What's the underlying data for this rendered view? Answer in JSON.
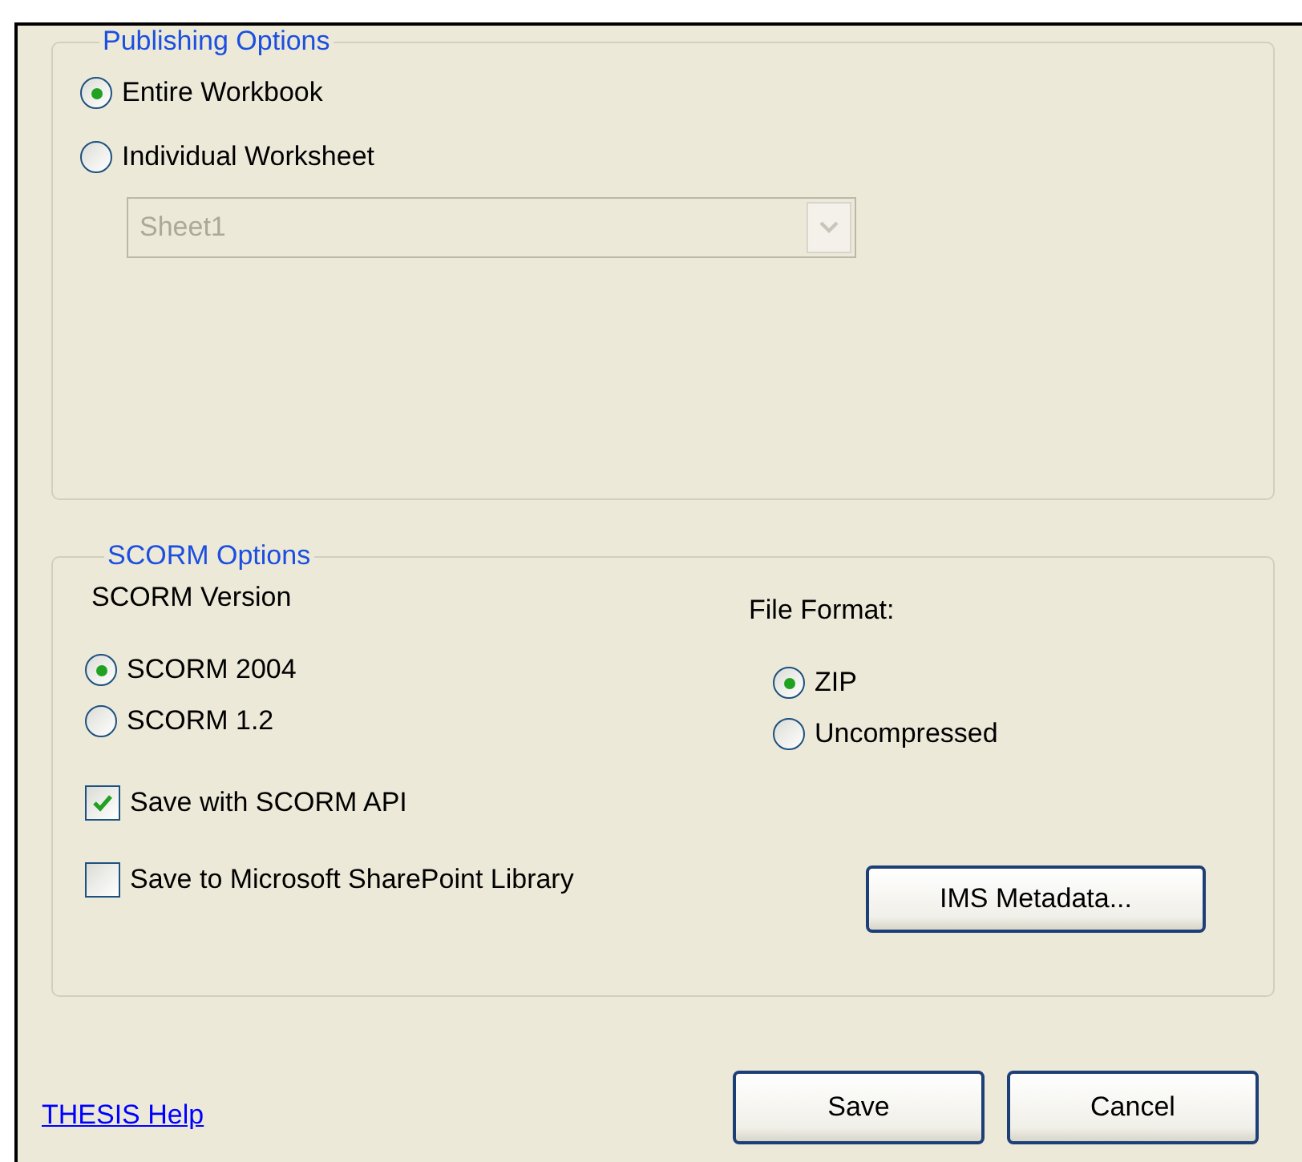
{
  "publishing_options": {
    "title": "Publishing Options",
    "radios": [
      {
        "label": "Entire Workbook",
        "selected": true
      },
      {
        "label": "Individual Worksheet",
        "selected": false
      }
    ],
    "worksheet_dropdown": {
      "value": "Sheet1",
      "disabled": true
    }
  },
  "scorm_options": {
    "title": "SCORM Options",
    "scorm_version": {
      "label": "SCORM Version",
      "radios": [
        {
          "label": "SCORM 2004",
          "selected": true
        },
        {
          "label": "SCORM 1.2",
          "selected": false
        }
      ]
    },
    "file_format": {
      "label": "File Format:",
      "radios": [
        {
          "label": "ZIP",
          "selected": true
        },
        {
          "label": "Uncompressed",
          "selected": false
        }
      ]
    },
    "checkboxes": [
      {
        "label": "Save with SCORM API",
        "checked": true
      },
      {
        "label": "Save to Microsoft SharePoint Library",
        "checked": false
      }
    ],
    "metadata_button": "IMS Metadata..."
  },
  "help_link": "THESIS Help",
  "buttons": [
    "Save",
    "Cancel"
  ]
}
